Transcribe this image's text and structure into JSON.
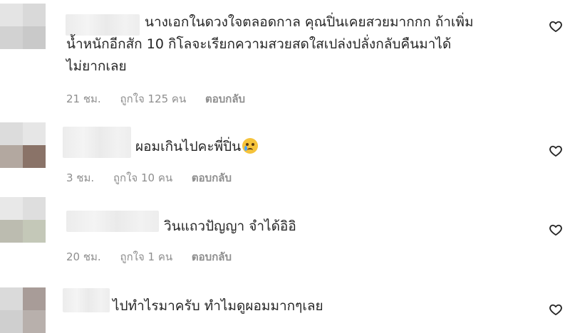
{
  "comments": [
    {
      "lines": [
        "นางเอกในดวงใจตลอดกาล คุณปิ่นเคยสวยมากกก ถ้าเพิ่ม",
        "น้ำหนักอีกสัก 10 กิโลจะเรียกความสวยสดใสเปล่งปลั่งกลับคืนมาได้",
        "ไม่ยากเลย"
      ],
      "time": "21 ชม.",
      "likes": "ถูกใจ 125 คน",
      "reply": "ตอบกลับ",
      "heart_icon": "heart-outline-icon"
    },
    {
      "lines": [
        "ผอมเกินไปคะพี่ปิ่น"
      ],
      "emoji": "crying-face-emoji",
      "time": "3 ชม.",
      "likes": "ถูกใจ 10 คน",
      "reply": "ตอบกลับ",
      "heart_icon": "heart-outline-icon"
    },
    {
      "lines": [
        "วินแถวปัญญา จำได้อิอิ"
      ],
      "time": "20 ชม.",
      "likes": "ถูกใจ 1 คน",
      "reply": "ตอบกลับ",
      "heart_icon": "heart-outline-icon"
    },
    {
      "lines": [
        "ไปทำไรมาครับ ทำไมดูผอมมากๆเลย"
      ],
      "heart_icon": "heart-outline-icon"
    }
  ]
}
